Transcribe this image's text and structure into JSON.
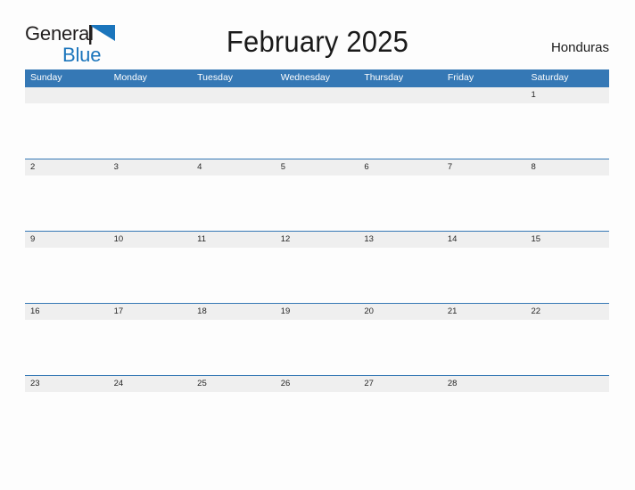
{
  "brand": {
    "name_part1": "General",
    "name_part2": "Blue",
    "flag_icon": "blue-triangle-flag-icon",
    "color_dark": "#221f1f",
    "color_blue": "#1b75bc"
  },
  "header": {
    "title": "February 2025",
    "country": "Honduras"
  },
  "colors": {
    "header_blue": "#3578b5",
    "row_band_gray": "#efefef",
    "page_background": "#fdfdfd",
    "text_dark": "#262626"
  },
  "calendar": {
    "month": "February",
    "year": "2025",
    "weekday_headers": [
      "Sunday",
      "Monday",
      "Tuesday",
      "Wednesday",
      "Thursday",
      "Friday",
      "Saturday"
    ],
    "weeks": [
      [
        "",
        "",
        "",
        "",
        "",
        "",
        "1"
      ],
      [
        "2",
        "3",
        "4",
        "5",
        "6",
        "7",
        "8"
      ],
      [
        "9",
        "10",
        "11",
        "12",
        "13",
        "14",
        "15"
      ],
      [
        "16",
        "17",
        "18",
        "19",
        "20",
        "21",
        "22"
      ],
      [
        "23",
        "24",
        "25",
        "26",
        "27",
        "28",
        ""
      ]
    ]
  }
}
